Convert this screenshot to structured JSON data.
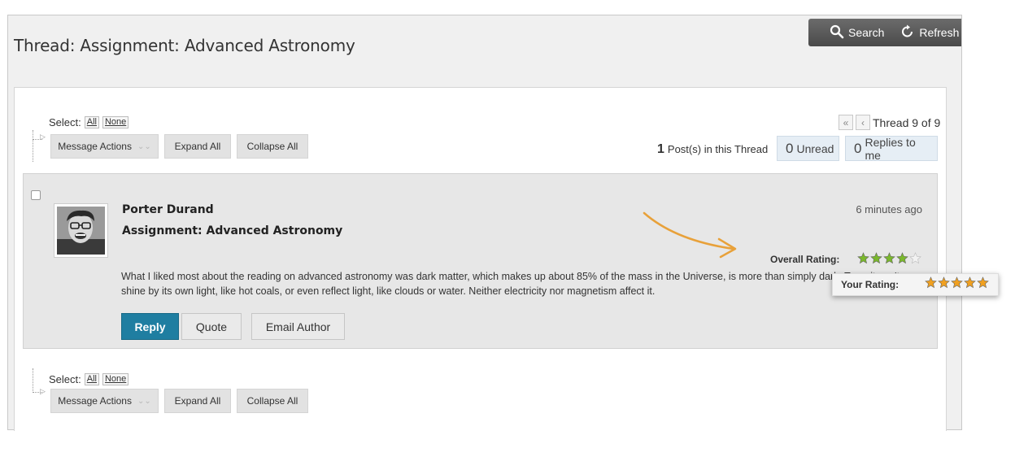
{
  "page": {
    "title": "Thread: Assignment: Advanced Astronomy"
  },
  "toolbar": {
    "search_label": "Search",
    "refresh_label": "Refresh"
  },
  "selection": {
    "label": "Select:",
    "all": "All",
    "none": "None"
  },
  "actions": {
    "message_actions": "Message Actions",
    "expand_all": "Expand All",
    "collapse_all": "Collapse All"
  },
  "pager": {
    "label": "Thread 9 of 9"
  },
  "thread_counts": {
    "posts_count": "1",
    "posts_label": "Post(s) in this Thread",
    "unread_count": "0",
    "unread_label": "Unread",
    "replies_count": "0",
    "replies_label": "Replies to me"
  },
  "post": {
    "author": "Porter Durand",
    "subject": "Assignment: Advanced Astronomy",
    "time": "6 minutes ago",
    "overall_rating_label": "Overall Rating:",
    "overall_rating": 4,
    "body": "What I liked most about the reading on advanced astronomy was dark matter, which makes up about 85% of the mass in the Universe, is more than simply dark. True, it can't shine by its own light, like hot coals, or even reflect light, like clouds or water. Neither electricity nor magnetism affect it.",
    "buttons": {
      "reply": "Reply",
      "quote": "Quote",
      "email_author": "Email Author"
    }
  },
  "your_rating": {
    "label": "Your Rating:",
    "value": 5
  },
  "colors": {
    "reply": "#1f7ea1",
    "star_green": "#7ab82c",
    "star_orange": "#f0a020",
    "arrow": "#e8a13a"
  }
}
